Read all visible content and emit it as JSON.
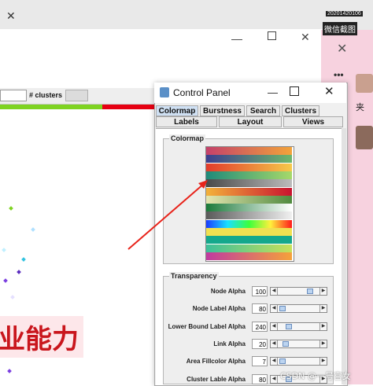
{
  "background": {
    "chinese_text": "业能力",
    "clusters_label": "# clusters"
  },
  "wechat": {
    "timestamp": "20201420106",
    "screenshot_title": "微信截图",
    "side_chars": "夹",
    "menu_dots": "•••"
  },
  "control_panel": {
    "title": "Control Panel",
    "tabs_row1": [
      "Colormap",
      "Burstness",
      "Search",
      "Clusters"
    ],
    "tabs_row2": [
      "Labels",
      "Layout",
      "Views"
    ],
    "active_tab": "Colormap",
    "colormap_section_title": "Colormap",
    "colormaps": [
      [
        "#c4416a",
        "#f2a33a"
      ],
      [
        "#3b3f8f",
        "#6db76b"
      ],
      [
        "#e23b2b",
        "#f5c94a"
      ],
      [
        "#1f8a7a",
        "#a6d96a"
      ],
      [
        "#4a4a4a",
        "#bcbcbc"
      ],
      [
        "#f3b13a",
        "#c9122f"
      ],
      [
        "#e5e5b0",
        "#4f8a3e"
      ],
      [
        "#1b7a3a",
        "#ffffff"
      ],
      [
        "#5a5a5a",
        "#f0f0f0"
      ],
      [
        "#1a3cff",
        "#ff1a1a"
      ],
      [
        "#f0e050",
        "#f0e050"
      ],
      [
        "#14a88c",
        "#14a88c"
      ],
      [
        "#3cbf9a",
        "#c7e05a"
      ],
      [
        "#c03aa0",
        "#f5a23a"
      ]
    ],
    "transparency_section_title": "Transparency",
    "transparency": [
      {
        "label": "Node Alpha",
        "value": "100",
        "level": 0.78
      },
      {
        "label": "Node Label Alpha",
        "value": "80",
        "level": 0.05
      },
      {
        "label": "Lower Bound Label Alpha",
        "value": "240",
        "level": 0.22
      },
      {
        "label": "Link Alpha",
        "value": "20",
        "level": 0.12
      },
      {
        "label": "Area Fillcolor Alpha",
        "value": "7",
        "level": 0.05
      },
      {
        "label": "Cluster Lable Alpha",
        "value": "80",
        "level": 0.22
      }
    ]
  },
  "watermark": "CSDN @一号宫女",
  "colors": {
    "accent_red": "#e60012",
    "accent_green": "#7ed321",
    "pink": "#f7d2df"
  }
}
